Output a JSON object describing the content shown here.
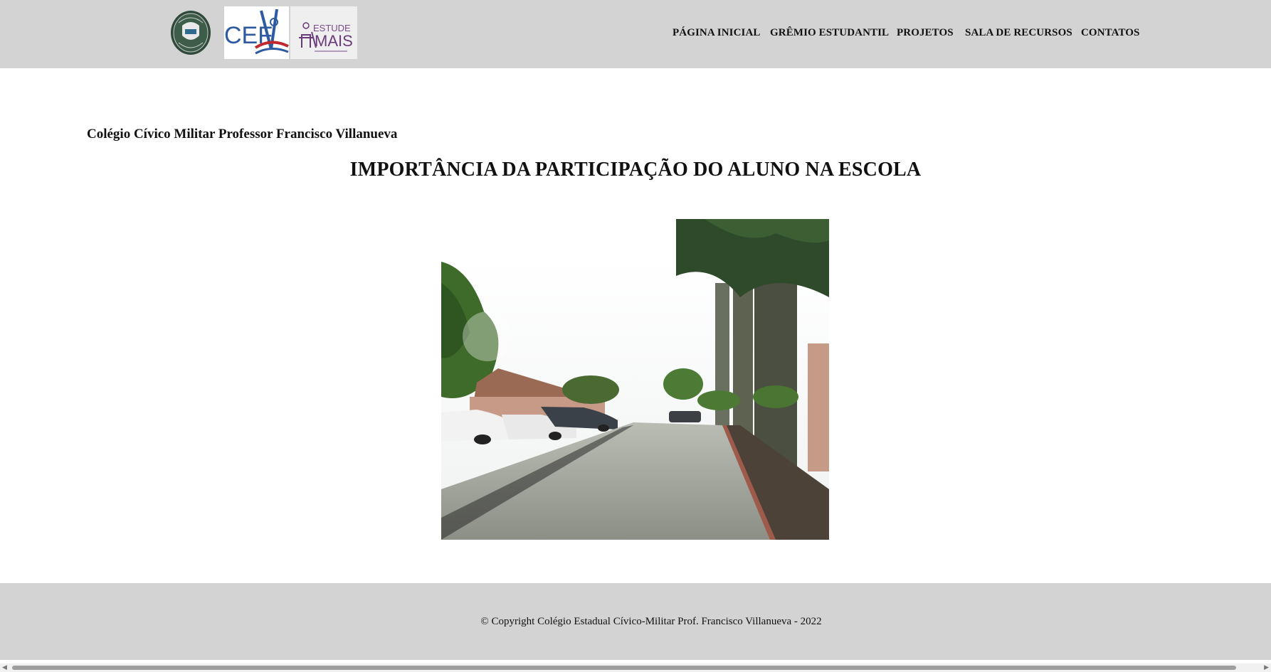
{
  "header": {
    "logo_cef_text": "CEF",
    "logo_estude_text": "ESTUDE MAIS",
    "nav": [
      {
        "label": "PÁGINA INICIAL"
      },
      {
        "label": "GRÊMIO ESTUDANTIL"
      },
      {
        "label": "PROJETOS"
      },
      {
        "label": "SALA DE RECURSOS"
      },
      {
        "label": "CONTATOS"
      }
    ]
  },
  "main": {
    "school_name": "Colégio Cívico Militar Professor Francisco Villanueva",
    "title": "IMPORTÂNCIA DA PARTICIPAÇÃO DO ALUNO NA ESCOLA"
  },
  "footer": {
    "copyright": "© Copyright Colégio Estadual Cívico-Militar Prof. Francisco Villanueva - 2022"
  },
  "colors": {
    "header_bg": "#d3d3d3",
    "footer_bg": "#d3d3d3",
    "text": "#111111"
  }
}
